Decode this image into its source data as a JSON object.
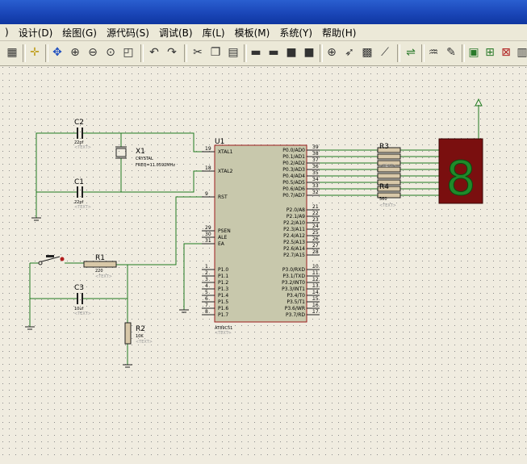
{
  "menu": [
    {
      "id": "view-partial",
      "label": ")"
    },
    {
      "id": "design",
      "label": "设计(D)"
    },
    {
      "id": "graph",
      "label": "绘图(G)"
    },
    {
      "id": "source",
      "label": "源代码(S)"
    },
    {
      "id": "debug",
      "label": "调试(B)"
    },
    {
      "id": "library",
      "label": "库(L)"
    },
    {
      "id": "template",
      "label": "模板(M)"
    },
    {
      "id": "system",
      "label": "系统(Y)"
    },
    {
      "id": "help",
      "label": "帮助(H)"
    }
  ],
  "toolbar_icons": [
    "grid",
    "origin",
    "pan",
    "zoom-in",
    "zoom-out",
    "zoom-all",
    "zoom-area",
    "undo",
    "redo",
    "cut",
    "copy",
    "paste",
    "block-copy",
    "block-move",
    "block-rotate",
    "block-delete",
    "pick-device",
    "make-device",
    "packaging-tool",
    "decompose",
    "wire-autorouter",
    "search-tag",
    "property-assignment",
    "new-sheet",
    "add-sheet",
    "remove-sheet",
    "netlist"
  ],
  "schematic": {
    "c2": {
      "ref": "C2",
      "value": "22pf",
      "tag": "<TEXT>"
    },
    "c1": {
      "ref": "C1",
      "value": "22pf",
      "tag": "<TEXT>"
    },
    "x1": {
      "ref": "X1",
      "type": "CRYSTAL",
      "freq": "FREQ=11.0592MHz"
    },
    "u1": {
      "ref": "U1",
      "part": "AT89C51",
      "tag": "<TEXT>"
    },
    "r1": {
      "ref": "R1",
      "value": "220",
      "tag": "<TEXT>"
    },
    "c3": {
      "ref": "C3",
      "value": "10uf",
      "tag": "<TEXT>"
    },
    "r2": {
      "ref": "R2",
      "value": "10K",
      "tag": "<TEXT>"
    },
    "r3": {
      "ref": "R3",
      "tag": "<TEXT>"
    },
    "r4": {
      "ref": "R4",
      "value": "560",
      "tag": "<TEXT>"
    },
    "seg": {
      "digit": "8",
      "color": "#1f8a2a"
    },
    "left_pins": [
      {
        "num": "19",
        "name": "XTAL1"
      },
      {
        "num": "18",
        "name": "XTAL2"
      },
      {
        "num": "9",
        "name": "RST"
      },
      {
        "num": "29",
        "name": "PSEN"
      },
      {
        "num": "30",
        "name": "ALE"
      },
      {
        "num": "31",
        "name": "EA"
      },
      {
        "num": "1",
        "name": "P1.0"
      },
      {
        "num": "2",
        "name": "P1.1"
      },
      {
        "num": "3",
        "name": "P1.2"
      },
      {
        "num": "4",
        "name": "P1.3"
      },
      {
        "num": "5",
        "name": "P1.4"
      },
      {
        "num": "6",
        "name": "P1.5"
      },
      {
        "num": "7",
        "name": "P1.6"
      },
      {
        "num": "8",
        "name": "P1.7"
      }
    ],
    "p0_pins": [
      {
        "name": "P0.0/AD0",
        "num": "39"
      },
      {
        "name": "P0.1/AD1",
        "num": "38"
      },
      {
        "name": "P0.2/AD2",
        "num": "37"
      },
      {
        "name": "P0.3/AD3",
        "num": "36"
      },
      {
        "name": "P0.4/AD4",
        "num": "35"
      },
      {
        "name": "P0.5/AD5",
        "num": "34"
      },
      {
        "name": "P0.6/AD6",
        "num": "33"
      },
      {
        "name": "P0.7/AD7",
        "num": "32"
      }
    ],
    "p2_pins": [
      {
        "name": "P2.0/A8",
        "num": "21"
      },
      {
        "name": "P2.1/A9",
        "num": "22"
      },
      {
        "name": "P2.2/A10",
        "num": "23"
      },
      {
        "name": "P2.3/A11",
        "num": "24"
      },
      {
        "name": "P2.4/A12",
        "num": "25"
      },
      {
        "name": "P2.5/A13",
        "num": "26"
      },
      {
        "name": "P2.6/A14",
        "num": "27"
      },
      {
        "name": "P2.7/A15",
        "num": "28"
      }
    ],
    "p3_pins": [
      {
        "name": "P3.0/RXD",
        "num": "10"
      },
      {
        "name": "P3.1/TXD",
        "num": "11"
      },
      {
        "name": "P3.2/INT0",
        "num": "12"
      },
      {
        "name": "P3.3/INT1",
        "num": "13"
      },
      {
        "name": "P3.4/T0",
        "num": "14"
      },
      {
        "name": "P3.5/T1",
        "num": "15"
      },
      {
        "name": "P3.6/WR",
        "num": "16"
      },
      {
        "name": "P3.7/RD",
        "num": "17"
      }
    ],
    "colors": {
      "wire": "#1f7a1f",
      "part": "#9c1c1c",
      "chip_fill": "#c8c8ac",
      "grid": "#8a8a8a",
      "canvas": "#f0ece0",
      "seg_bg": "#7a0f0f"
    }
  }
}
